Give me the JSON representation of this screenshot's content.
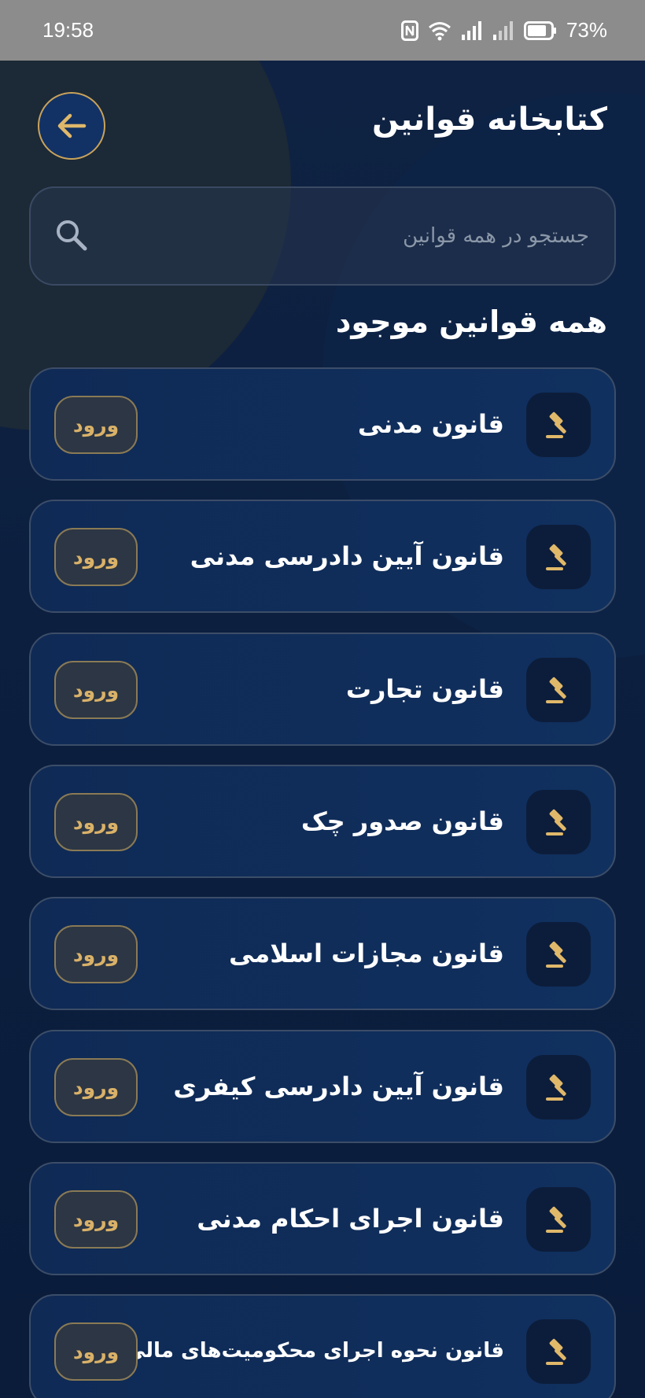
{
  "status_bar": {
    "time": "19:58",
    "battery": "73%",
    "icons": [
      "nfc-icon",
      "wifi-icon",
      "signal-icon",
      "signal-weak-icon",
      "battery-icon"
    ]
  },
  "header": {
    "title": "کتابخانه قوانین",
    "back_icon": "arrow-left-icon"
  },
  "search": {
    "placeholder": "جستجو در همه قوانین",
    "value": ""
  },
  "section_title": "همه قوانین موجود",
  "laws": [
    {
      "label": "قانون مدنی",
      "button": "ورود",
      "icon": "gavel-icon"
    },
    {
      "label": "قانون آیین دادرسی مدنی",
      "button": "ورود",
      "icon": "gavel-icon"
    },
    {
      "label": "قانون تجارت",
      "button": "ورود",
      "icon": "gavel-icon"
    },
    {
      "label": "قانون صدور چک",
      "button": "ورود",
      "icon": "gavel-icon"
    },
    {
      "label": "قانون مجازات اسلامی",
      "button": "ورود",
      "icon": "gavel-icon"
    },
    {
      "label": "قانون آیین دادرسی کیفری",
      "button": "ورود",
      "icon": "gavel-icon"
    },
    {
      "label": "قانون اجرای احکام مدنی",
      "button": "ورود",
      "icon": "gavel-icon"
    },
    {
      "label": "قانون نحوه اجرای محکومیت‌های مالی",
      "button": "ورود",
      "icon": "gavel-icon"
    }
  ],
  "colors": {
    "background": "#0b1a33",
    "card": "#10305f",
    "accent_gold": "#d9b168",
    "back_button": "#123266"
  }
}
